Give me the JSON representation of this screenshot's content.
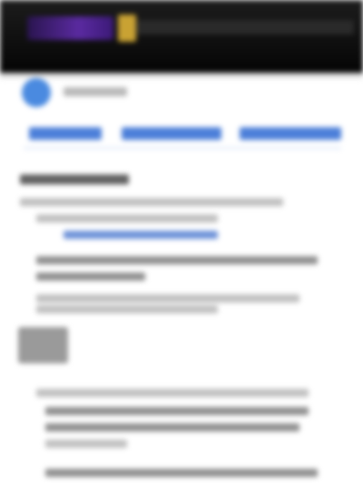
{
  "header": {
    "brand_icon": "brand-logo-icon"
  },
  "post": {
    "avatar_icon": "user-avatar-icon",
    "author": "",
    "tabs": [
      {
        "label": ""
      },
      {
        "label": ""
      },
      {
        "label": ""
      }
    ]
  },
  "colors": {
    "header_bg": "#0a0a0a",
    "brand_purple": "#4a2290",
    "brand_gold": "#c9a233",
    "tab_blue": "#4c7fd9",
    "avatar_blue": "#4a8ae0"
  }
}
